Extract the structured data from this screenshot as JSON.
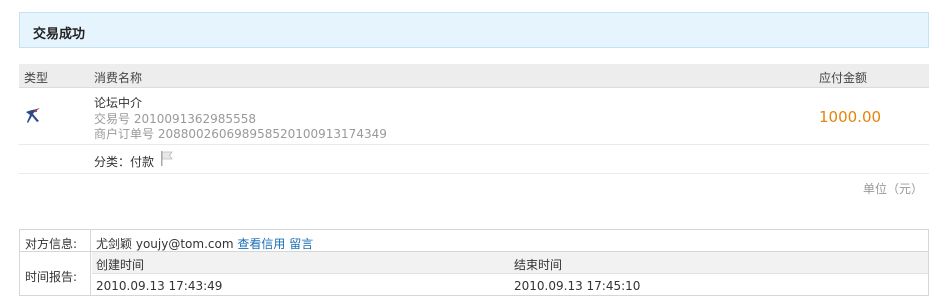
{
  "banner": {
    "title": "交易成功"
  },
  "table": {
    "headers": {
      "type": "类型",
      "name": "消费名称",
      "amount": "应付金额"
    },
    "item": {
      "name": "论坛中介",
      "trade_no": "交易号 2010091362985558",
      "order_no": "商户订单号 20880026069895852010091317434​9",
      "amount": "1000.00",
      "type_icon": "swallow-logo-icon"
    },
    "category": {
      "text": "分类：付款",
      "icon": "flag-icon"
    }
  },
  "unit": "单位（元）",
  "info": {
    "party_label": "对方信息:",
    "party_name": "尤剑颖",
    "party_email": "youjy@tom.com",
    "credit_link": "查看信用",
    "message_link": "留言",
    "time_label": "时间报告:",
    "created_header": "创建时间",
    "ended_header": "结束时间",
    "created_value": "2010.09.13 17:43:49",
    "ended_value": "2010.09.13 17:45:10"
  },
  "colors": {
    "amount": "#e3850a",
    "link": "#1a6fb6",
    "banner_bg": "#e6f4fd"
  }
}
